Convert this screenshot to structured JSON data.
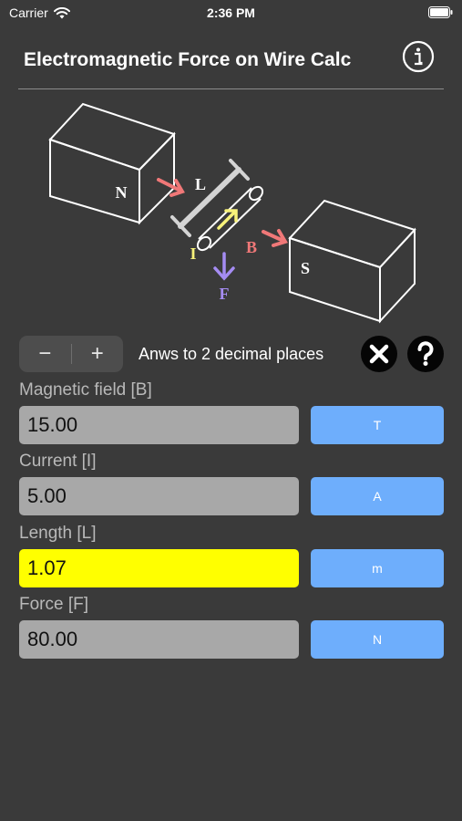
{
  "status_bar": {
    "carrier": "Carrier",
    "time": "2:36 PM"
  },
  "header": {
    "title": "Electromagnetic Force on Wire Calc",
    "info_icon": "info-icon"
  },
  "diagram": {
    "magnet_north_label": "N",
    "magnet_south_label": "S",
    "length_label": "L",
    "current_label": "I",
    "field_label": "B",
    "force_label": "F",
    "colors": {
      "field_arrow": "#f07878",
      "current_arrow": "#f7f27a",
      "force_arrow": "#a58cf3",
      "length_bar": "#d4d4d4"
    }
  },
  "controls": {
    "decrement_label": "−",
    "increment_label": "+",
    "decimals_text": "Anws to 2 decimal places",
    "clear_icon": "close-icon",
    "help_icon": "question-icon"
  },
  "fields": [
    {
      "label": "Magnetic field [B]",
      "value": "15.00",
      "unit": "T",
      "highlighted": false
    },
    {
      "label": "Current [I]",
      "value": "5.00",
      "unit": "A",
      "highlighted": false
    },
    {
      "label": "Length [L]",
      "value": "1.07",
      "unit": "m",
      "highlighted": true
    },
    {
      "label": "Force [F]",
      "value": "80.00",
      "unit": "N",
      "highlighted": false
    }
  ],
  "colors": {
    "background": "#3a3a3a",
    "value_box": "#a8a8a8",
    "highlight": "#ffff00",
    "unit_button": "#6eaefc"
  }
}
